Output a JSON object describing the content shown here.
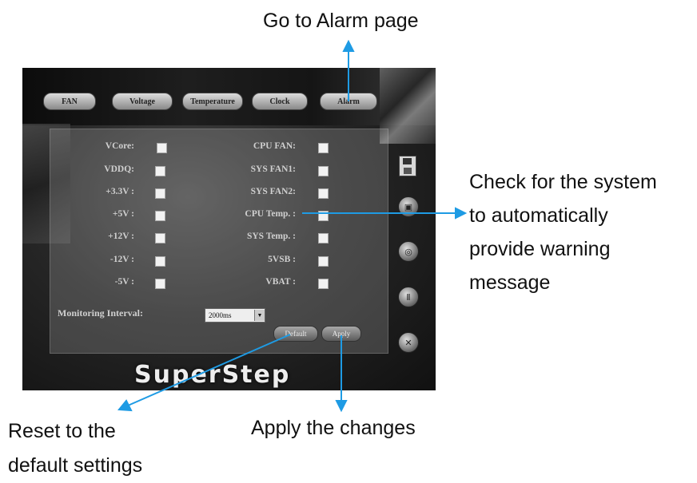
{
  "annotations": {
    "alarm": "Go to Alarm page",
    "check": [
      "Check for the system",
      "to automatically",
      "provide warning",
      "message"
    ],
    "reset": [
      "Reset to the",
      "default settings"
    ],
    "apply": "Apply the changes"
  },
  "tabs": [
    "FAN",
    "Voltage",
    "Temperature",
    "Clock",
    "Alarm"
  ],
  "left_items": [
    "VCore:",
    "VDDQ:",
    "+3.3V :",
    "+5V :",
    "+12V :",
    "-12V :",
    "-5V :"
  ],
  "right_items": [
    "CPU FAN:",
    "SYS FAN1:",
    "SYS FAN2:",
    "CPU Temp. :",
    "SYS Temp. :",
    "5VSB :",
    "VBAT :"
  ],
  "monitoring": {
    "label": "Monitoring Interval:",
    "value": "2000ms"
  },
  "buttons": {
    "default": "Default",
    "apply": "Apply"
  },
  "brand": "SuperStep",
  "side_icons": [
    "save-icon",
    "monitor-icon",
    "settings-icon",
    "tools-icon",
    "wrench-icon"
  ],
  "colors": {
    "arrow": "#1e9be4"
  }
}
